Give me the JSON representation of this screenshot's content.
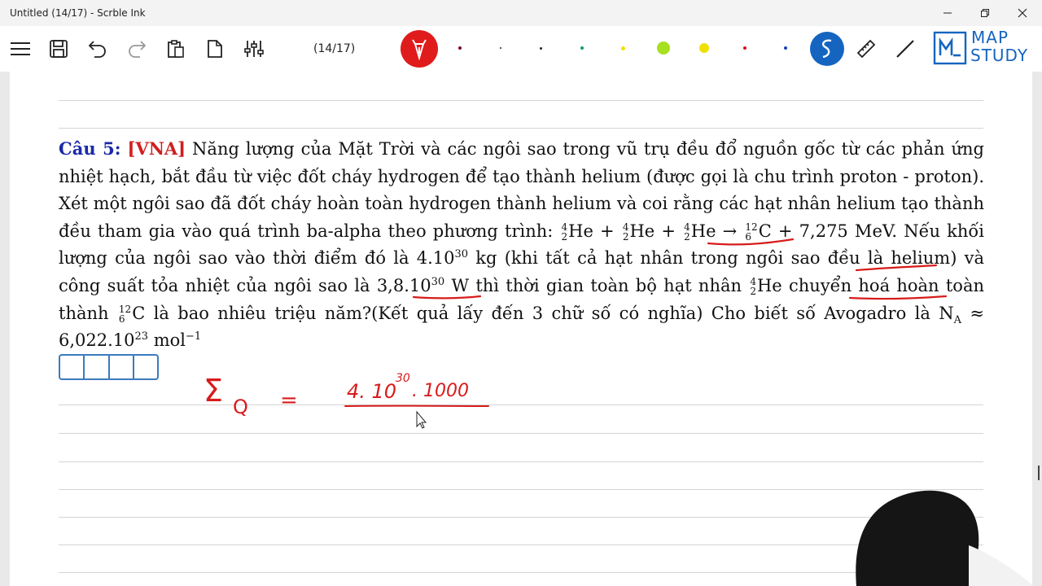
{
  "window": {
    "title": "Untitled (14/17) - Scrble Ink"
  },
  "toolbar": {
    "page_indicator": "(14/17)",
    "brand": {
      "line1": "MAP",
      "line2": "STUDY"
    },
    "pen_colors": [
      "#c00000",
      "#7a0033",
      "#222222",
      "#222222",
      "#0aa05a",
      "#f0e000",
      "#a6e01e",
      "#f0e000",
      "#e01010",
      "#1a40c0"
    ]
  },
  "question": {
    "label": "Câu 5:",
    "tag": "[VNA]",
    "t1": " Năng lượng của Mặt Trời và các ngôi sao trong vũ trụ đều đổ nguồn gốc từ các phản ứng nhiệt hạch, bắt đầu từ việc đốt cháy hydrogen để tạo thành helium (được gọi là chu trình proton - proton). Xét một ngôi sao đã đốt cháy hoàn toàn hydrogen thành helium và coi rằng các hạt nhân helium tạo thành đều tham gia vào quá trình ",
    "hl_process": "ba-alpha",
    "t2": " theo phương trình: ",
    "he_mass": "4",
    "he_charge": "2",
    "he_symbol": "He",
    "plus": " + ",
    "arrow": " → ",
    "c_mass": "12",
    "c_charge": "6",
    "c_symbol": "C",
    "energy": " + 7,275 MeV",
    "t3": ". Nếu khối lượng của ngôi sao vào thời điểm đó là ",
    "mass_base": "4.10",
    "mass_exp": "30",
    "mass_unit": " kg",
    "t4": " (khi tất cả hạt nhân trong ngôi sao đều là ",
    "hl_helium": "helium",
    "t5": ") và công suất tỏa nhiệt của ngôi sao là ",
    "power_base": "3,8.10",
    "power_exp": "30",
    "power_unit": " W",
    "t6": " thì thời gian toàn bộ hạt nhân ",
    "t7": "He chuyển hoá hoàn toàn thành ",
    "t8": "C là bao nhiêu triệu năm?(Kết quả lấy đến 3 chữ số có nghĩa) Cho biết số Avogadro là ",
    "na_symbol": "N",
    "na_sub": "A",
    "na_value": " ≈ 6,022.10",
    "na_exp": "23",
    "na_unit": " mol",
    "na_unit_exp": "−1"
  },
  "handwriting": {
    "lhs": "Σ",
    "lhs_sub": "Q",
    "equals": "=",
    "numerator": "4. 10",
    "numerator_exp": "30",
    "numerator_tail": ". 1000"
  }
}
